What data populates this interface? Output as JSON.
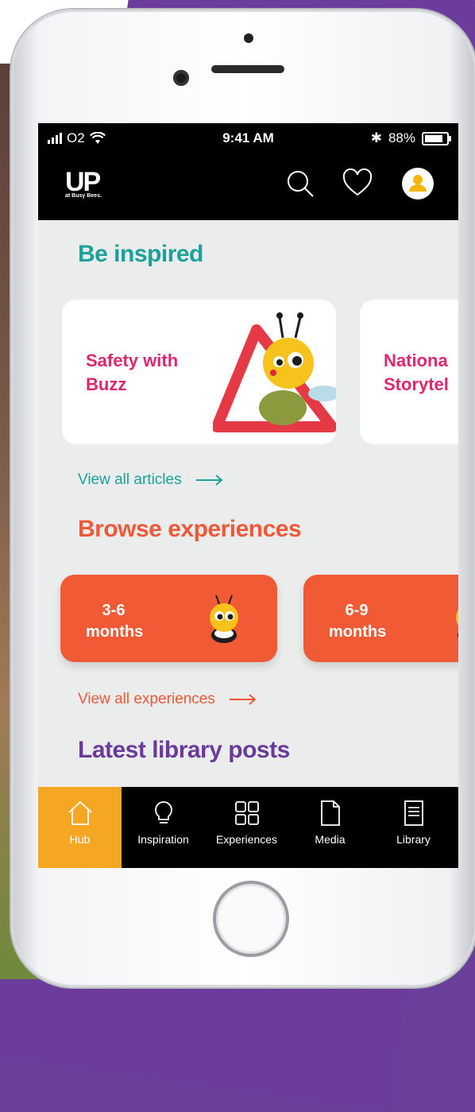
{
  "status_bar": {
    "carrier": "O2",
    "time": "9:41 AM",
    "battery": "88%"
  },
  "app": {
    "logo_main": "UP",
    "logo_sub": "at Busy Bees.",
    "icons": [
      "search-icon",
      "heart-icon",
      "profile-icon"
    ]
  },
  "inspire": {
    "heading": "Be inspired",
    "cards": [
      {
        "title_line1": "Safety with",
        "title_line2": "Buzz"
      },
      {
        "title_line1": "Nationa",
        "title_line2": "Storytel"
      }
    ],
    "view_all": "View all articles"
  },
  "experiences": {
    "heading": "Browse experiences",
    "cards": [
      {
        "line1": "3-6",
        "line2": "months"
      },
      {
        "line1": "6-9",
        "line2": "months"
      }
    ],
    "view_all": "View all experiences"
  },
  "library": {
    "heading": "Latest library posts"
  },
  "tabs": [
    {
      "label": "Hub",
      "icon": "home-icon",
      "active": true
    },
    {
      "label": "Inspiration",
      "icon": "lightbulb-icon",
      "active": false
    },
    {
      "label": "Experiences",
      "icon": "grid-icon",
      "active": false
    },
    {
      "label": "Media",
      "icon": "document-icon",
      "active": false
    },
    {
      "label": "Library",
      "icon": "notebook-icon",
      "active": false
    }
  ],
  "colors": {
    "teal": "#1aa29a",
    "orange": "#f0583a",
    "purple": "#6a3a9a",
    "pink": "#e0266e",
    "tab_active": "#f5a623"
  }
}
